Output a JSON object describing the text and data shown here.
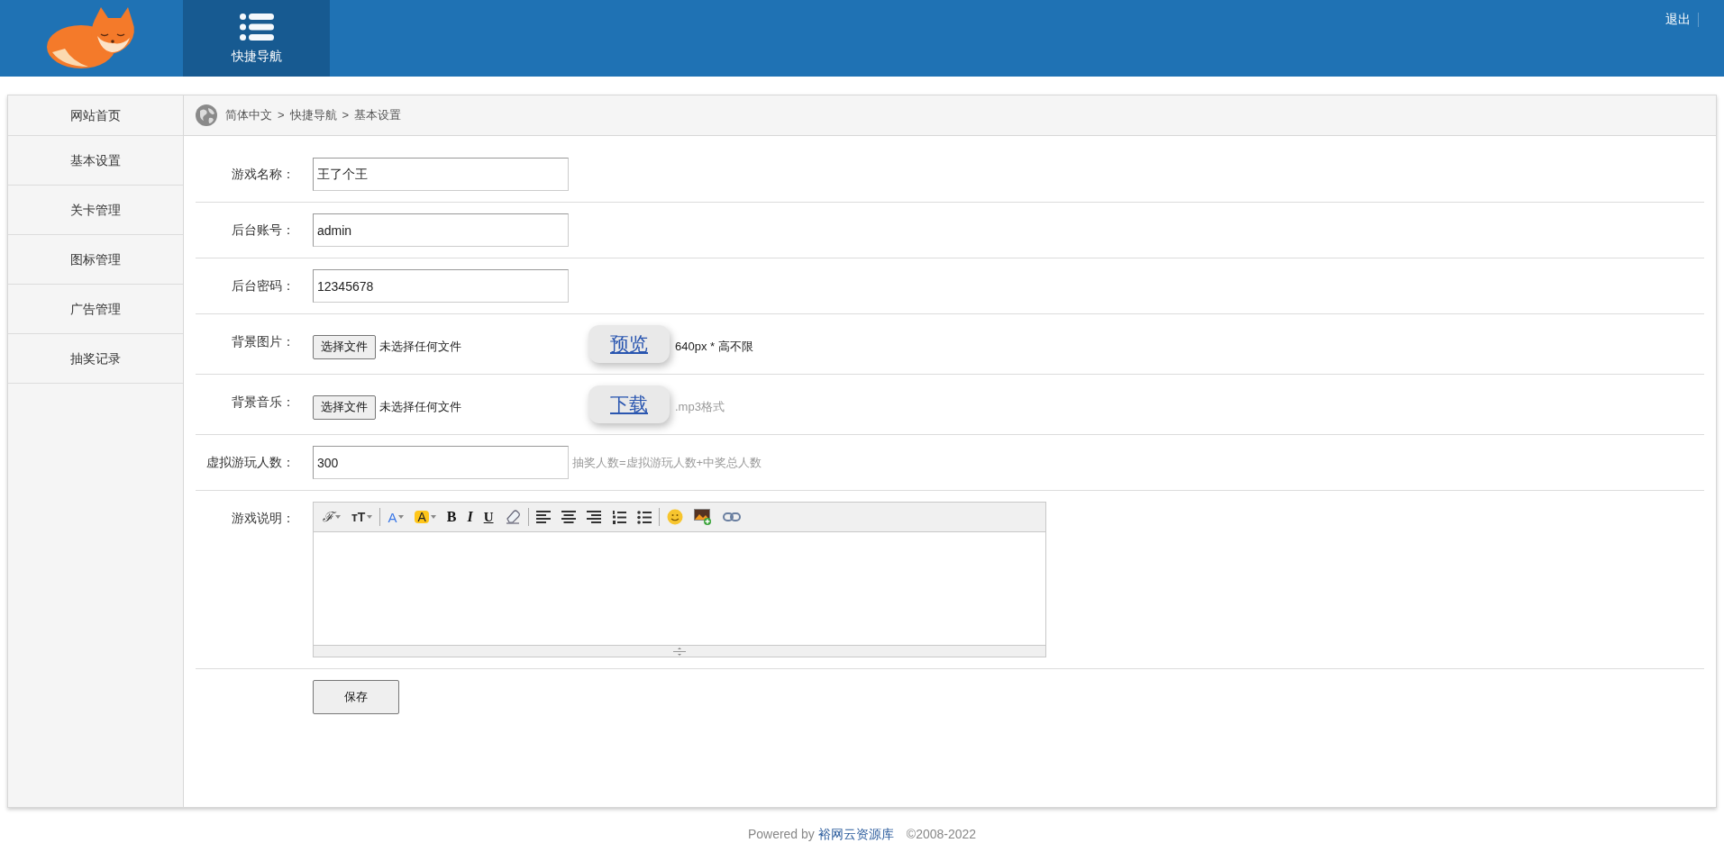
{
  "header": {
    "nav_tabs": [
      {
        "label": "快捷导航",
        "selected": true
      }
    ],
    "logout": "退出"
  },
  "sidebar": {
    "items": [
      {
        "label": "网站首页"
      },
      {
        "label": "基本设置"
      },
      {
        "label": "关卡管理"
      },
      {
        "label": "图标管理"
      },
      {
        "label": "广告管理"
      },
      {
        "label": "抽奖记录"
      }
    ]
  },
  "breadcrumb": {
    "items": [
      "简体中文",
      "快捷导航",
      "基本设置"
    ],
    "separators": [
      ">",
      ">"
    ]
  },
  "form": {
    "rows": [
      {
        "kind": "text",
        "label": "游戏名称：",
        "value": "王了个王"
      },
      {
        "kind": "text",
        "label": "后台账号：",
        "value": "admin"
      },
      {
        "kind": "text",
        "label": "后台密码：",
        "value": "12345678"
      },
      {
        "kind": "file",
        "label": "背景图片：",
        "button": "选择文件",
        "status": "未选择任何文件",
        "action": "预览",
        "hint": "640px * 高不限",
        "muted": false
      },
      {
        "kind": "file",
        "label": "背景音乐：",
        "button": "选择文件",
        "status": "未选择任何文件",
        "action": "下载",
        "hint": ".mp3格式",
        "muted": true
      },
      {
        "kind": "text",
        "label": "虚拟游玩人数：",
        "value": "300",
        "hint": "抽奖人数=虚拟游玩人数+中奖总人数",
        "muted": true
      },
      {
        "kind": "editor",
        "label": "游戏说明：",
        "toolbar": [
          [
            {
              "kind": "font",
              "glyph": "ℱ"
            },
            {
              "kind": "size",
              "glyph": "ᴛT"
            }
          ],
          [
            {
              "kind": "color",
              "glyph": "A"
            },
            {
              "kind": "highlight",
              "glyph": "A"
            },
            {
              "kind": "bold",
              "glyph": "B"
            },
            {
              "kind": "italic",
              "glyph": "I"
            },
            {
              "kind": "underline",
              "glyph": "U"
            },
            {
              "kind": "eraser"
            }
          ],
          [
            {
              "kind": "align-left"
            },
            {
              "kind": "align-center"
            },
            {
              "kind": "align-right"
            },
            {
              "kind": "ordered-list"
            },
            {
              "kind": "bullet-list"
            }
          ],
          [
            {
              "kind": "emoji"
            },
            {
              "kind": "image"
            },
            {
              "kind": "link"
            }
          ]
        ]
      }
    ],
    "submit": "保存"
  },
  "footer": {
    "powered_by": "Powered by",
    "link": "裕网云资源库",
    "copyright": "©2008-2022"
  }
}
